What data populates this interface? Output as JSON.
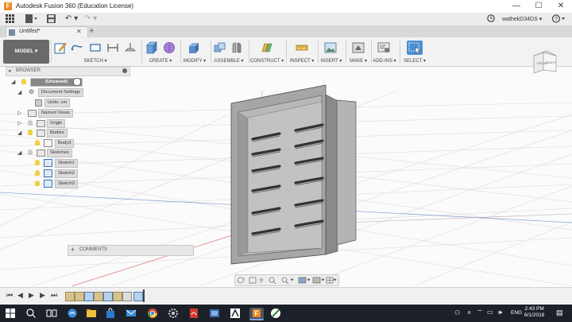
{
  "window": {
    "title": "Autodesk Fusion 360 (Education License)",
    "logo_letter": "F",
    "minimize": "—",
    "maximize": "☐",
    "close": "✕"
  },
  "appbar": {
    "user": "wathekD34DS ▾",
    "grid_icon": "grid-icon",
    "file_icon": "file-icon",
    "save_icon": "save-icon",
    "undo_icon": "undo-icon",
    "redo_icon": "redo-icon",
    "clock_icon": "clock-icon",
    "help_icon": "help-icon"
  },
  "tabs": {
    "document": "Untitled*",
    "close": "✕",
    "new": "+"
  },
  "ribbon": {
    "workspace": "MODEL ▾",
    "groups": [
      {
        "label": "SKETCH ▾"
      },
      {
        "label": "CREATE ▾"
      },
      {
        "label": "MODIFY ▾"
      },
      {
        "label": "ASSEMBLE ▾"
      },
      {
        "label": "CONSTRUCT ▾"
      },
      {
        "label": "INSPECT ▾"
      },
      {
        "label": "INSERT ▾"
      },
      {
        "label": "MAKE ▾"
      },
      {
        "label": "ADD-INS ▾"
      },
      {
        "label": "SELECT ▾"
      }
    ]
  },
  "browser": {
    "title": "BROWSER",
    "root": "(Unsaved)",
    "items": [
      {
        "label": "Document Settings"
      },
      {
        "label": "Units: cm"
      },
      {
        "label": "Named Views"
      },
      {
        "label": "Origin"
      },
      {
        "label": "Bodies"
      },
      {
        "label": "Body3"
      },
      {
        "label": "Sketches"
      },
      {
        "label": "Sketch1"
      },
      {
        "label": "Sketch2"
      },
      {
        "label": "Sketch3"
      }
    ]
  },
  "comments": {
    "label": "COMMENTS",
    "plus": "+"
  },
  "viewcube": {
    "front": "FRONT",
    "right": "RIGHT"
  },
  "taskbar": {
    "language": "ENG",
    "time": "2:43 PM",
    "date": "6/1/2018"
  },
  "colors": {
    "accent": "#f08a24",
    "select": "#4a8fd0",
    "taskbar": "#1c2129",
    "model_face": "#a8a8a8"
  }
}
